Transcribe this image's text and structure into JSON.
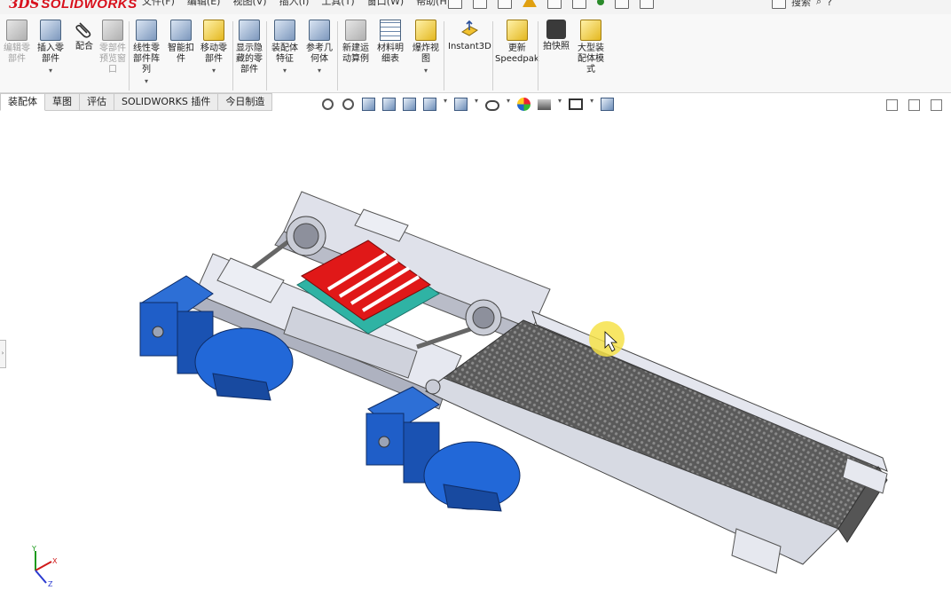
{
  "app": {
    "logo_prefix": "3DS",
    "logo_text": "SOLIDWORKS"
  },
  "menu": [
    "文件(F)",
    "编辑(E)",
    "视图(V)",
    "插入(I)",
    "工具(T)",
    "窗口(W)",
    "帮助(H)"
  ],
  "search": {
    "label": "搜索"
  },
  "ribbon": {
    "items": [
      {
        "label": "编辑零\n部件",
        "icon": "edit-component-icon",
        "disabled": true
      },
      {
        "label": "插入零\n部件",
        "icon": "insert-component-icon",
        "disabled": false,
        "caret": true
      },
      {
        "label": "配合",
        "icon": "mate-icon",
        "disabled": false
      },
      {
        "label": "零部件\n预览窗\n口",
        "icon": "component-preview-icon",
        "disabled": true
      },
      {
        "label": "线性零\n部件阵\n列",
        "icon": "linear-pattern-icon",
        "disabled": false,
        "caret": true
      },
      {
        "label": "智能扣\n件",
        "icon": "smart-fasteners-icon",
        "disabled": false
      },
      {
        "label": "移动零\n部件",
        "icon": "move-component-icon",
        "disabled": false,
        "caret": true
      },
      {
        "label": "显示隐\n藏的零\n部件",
        "icon": "show-hidden-icon",
        "disabled": false
      },
      {
        "label": "装配体\n特征",
        "icon": "assembly-features-icon",
        "disabled": false,
        "caret": true
      },
      {
        "label": "参考几\n何体",
        "icon": "reference-geometry-icon",
        "disabled": false,
        "caret": true
      },
      {
        "label": "新建运\n动算例",
        "icon": "new-motion-study-icon",
        "disabled": false
      },
      {
        "label": "材料明\n细表",
        "icon": "bill-of-materials-icon",
        "disabled": false
      },
      {
        "label": "爆炸视\n图",
        "icon": "exploded-view-icon",
        "disabled": false,
        "caret": true
      },
      {
        "label": "Instant3D",
        "icon": "instant3d-icon",
        "disabled": false
      },
      {
        "label": "更新\nSpeedpak",
        "icon": "update-speedpak-icon",
        "disabled": false
      },
      {
        "label": "拍快照",
        "icon": "take-snapshot-icon",
        "disabled": false
      },
      {
        "label": "大型装\n配体模\n式",
        "icon": "large-assembly-mode-icon",
        "disabled": false
      }
    ]
  },
  "tabs": [
    "装配体",
    "草图",
    "评估",
    "SOLIDWORKS 插件",
    "今日制造"
  ],
  "active_tab": "装配体",
  "heads_up_toolbar": [
    "zoom-to-fit-icon",
    "zoom-to-area-icon",
    "previous-view-icon",
    "section-view-icon",
    "dynamic-annotation-icon",
    "view-orientation-icon",
    "display-style-icon",
    "hide-show-items-icon",
    "edit-appearance-icon",
    "apply-scene-icon",
    "view-settings-icon",
    "rotate-view-icon"
  ],
  "colors": {
    "brand": "#d8101c",
    "motor_blue": "#1f5ec8",
    "fixture_red": "#e01818",
    "rail_cyan": "#3ab8a8",
    "frame_gray": "#d4d7e0",
    "belt_dark": "#4a4a4a"
  },
  "triad": {
    "x": "X",
    "y": "Y",
    "z": "Z"
  }
}
